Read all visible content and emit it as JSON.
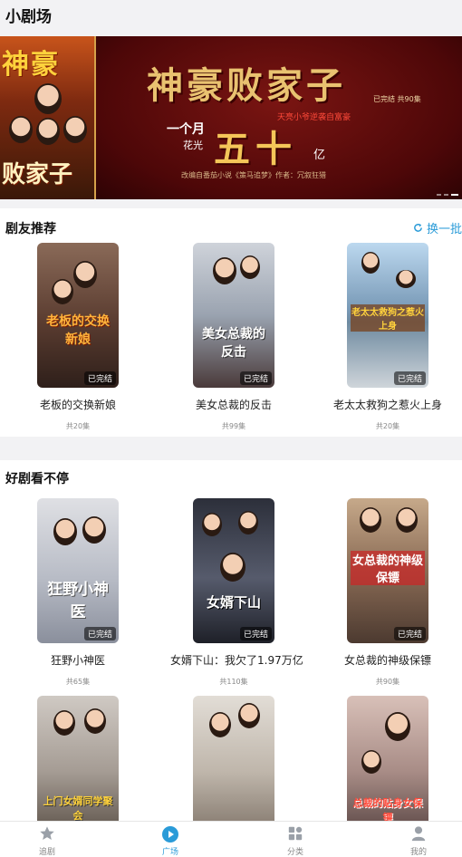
{
  "app": {
    "title": "小剧场"
  },
  "banner": {
    "poster_title_top": "神豪",
    "poster_title_bottom": "败家子",
    "headline": "神豪败家子",
    "status": "已完结 共90集",
    "red_tagline": "天亮小爷逆袭自富豪",
    "line_month": "一个月",
    "line_spend": "花光",
    "big_number": "五十",
    "unit": "亿",
    "credit": "改编自番茄小说《策马追梦》作者：冗叙狂猎"
  },
  "recommend": {
    "title": "剧友推荐",
    "refresh_label": "换一批",
    "items": [
      {
        "name": "老板的交换新娘",
        "badge": "已完结",
        "eps": "共20集",
        "cover_text": "老板的交换新娘"
      },
      {
        "name": "美女总裁的反击",
        "badge": "已完结",
        "eps": "共99集",
        "cover_text": "美女总裁的反击"
      },
      {
        "name": "老太太救狗之惹火上身",
        "badge": "已完结",
        "eps": "共20集",
        "cover_text": "老太太救狗之惹火上身"
      }
    ]
  },
  "binge": {
    "title": "好剧看不停",
    "items": [
      {
        "name": "狂野小神医",
        "badge": "已完结",
        "eps": "共65集",
        "cover_text": "狂野小神医"
      },
      {
        "name": "女婿下山：我欠了1.97万亿",
        "badge": "已完结",
        "eps": "共110集",
        "cover_text": "女婿下山"
      },
      {
        "name": "女总裁的神级保镖",
        "badge": "已完结",
        "eps": "共90集",
        "cover_text": "女总裁的神级保镖"
      }
    ],
    "more_covers": [
      {
        "cover_text": "上门女婿同学聚会"
      },
      {
        "cover_text": ""
      },
      {
        "cover_text": "总裁的贴身女保镖"
      }
    ]
  },
  "tabbar": {
    "items": [
      {
        "label": "追剧",
        "icon": "star-icon"
      },
      {
        "label": "广场",
        "icon": "play-icon"
      },
      {
        "label": "分类",
        "icon": "grid-icon"
      },
      {
        "label": "我的",
        "icon": "user-icon"
      }
    ],
    "active_color": "#2a9bd8"
  }
}
